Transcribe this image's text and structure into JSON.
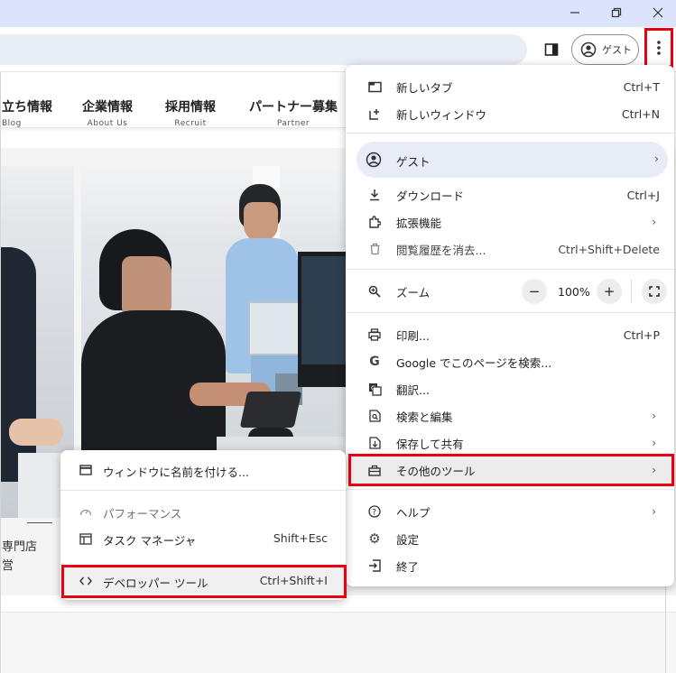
{
  "browser": {
    "guest_label": "ゲスト"
  },
  "site_nav": [
    {
      "jp": "立ち情報",
      "en": "Blog"
    },
    {
      "jp": "企業情報",
      "en": "About Us"
    },
    {
      "jp": "採用情報",
      "en": "Recruit"
    },
    {
      "jp": "パートナー募集",
      "en": "Partner"
    }
  ],
  "page_text": {
    "store_line1": "専門店",
    "store_line2": "営"
  },
  "menu": {
    "new_tab": {
      "label": "新しいタブ",
      "shortcut": "Ctrl+T"
    },
    "new_window": {
      "label": "新しいウィンドウ",
      "shortcut": "Ctrl+N"
    },
    "guest": {
      "label": "ゲスト"
    },
    "downloads": {
      "label": "ダウンロード",
      "shortcut": "Ctrl+J"
    },
    "extensions": {
      "label": "拡張機能"
    },
    "clear_history": {
      "label": "閲覧履歴を消去...",
      "shortcut": "Ctrl+Shift+Delete"
    },
    "zoom": {
      "label": "ズーム",
      "minus": "−",
      "value": "100%",
      "plus": "+"
    },
    "print": {
      "label": "印刷...",
      "shortcut": "Ctrl+P"
    },
    "google_search": {
      "label": "Google でこのページを検索..."
    },
    "translate": {
      "label": "翻訳..."
    },
    "search_edit": {
      "label": "検索と編集"
    },
    "save_share": {
      "label": "保存して共有"
    },
    "more_tools": {
      "label": "その他のツール"
    },
    "help": {
      "label": "ヘルプ"
    },
    "settings": {
      "label": "設定"
    },
    "exit": {
      "label": "終了"
    }
  },
  "submenu": {
    "name_window": {
      "label": "ウィンドウに名前を付ける..."
    },
    "performance": {
      "label": "パフォーマンス"
    },
    "task_manager": {
      "label": "タスク マネージャ",
      "shortcut": "Shift+Esc"
    },
    "devtools": {
      "label": "デベロッパー ツール",
      "shortcut": "Ctrl+Shift+I"
    }
  },
  "colors": {
    "highlight": "#e60012",
    "titlebar": "#dbe4fb",
    "omnibox": "#e9edf6",
    "guest_row": "#e8ecf7"
  }
}
